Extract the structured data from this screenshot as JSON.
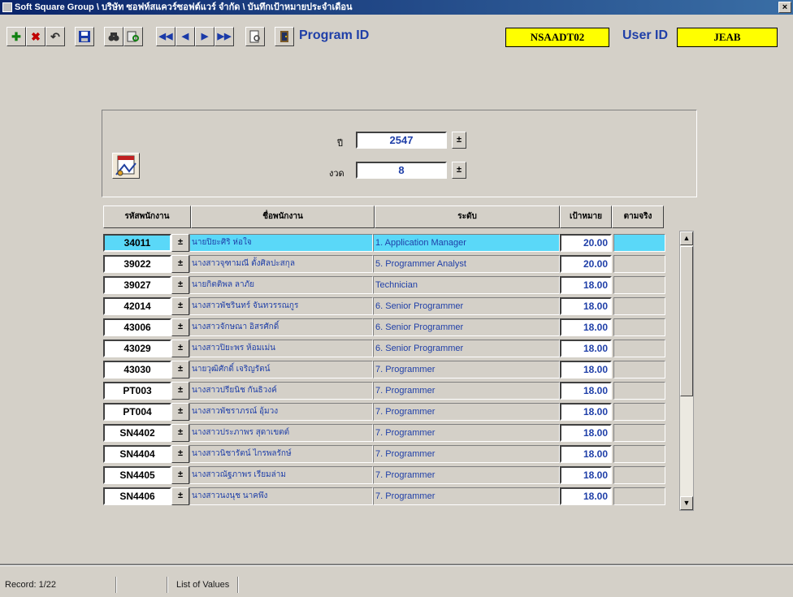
{
  "window": {
    "title": "Soft Square Group \\ บริษัท ซอฟท์สแควร์ซอฟต์แวร์ จำกัด \\ บันทึกเป้าหมายประจำเดือน",
    "close_glyph": "×"
  },
  "toolbar": {
    "program_id_label": "Program ID",
    "program_id_value": "NSAADT02",
    "user_id_label": "User ID",
    "user_id_value": "JEAB",
    "colors": {
      "label": "#1f3fa8",
      "id_box": "#ffff00"
    }
  },
  "form": {
    "year_label": "ปี",
    "year_value": "2547",
    "period_label": "งวด",
    "period_value": "8",
    "lov_glyph": "±"
  },
  "table": {
    "headers": [
      "รหัสพนักงาน",
      "ชื่อพนักงาน",
      "ระดับ",
      "เป้าหมาย",
      "ตามจริง"
    ],
    "rows": [
      {
        "code": "34011",
        "name": "นายปิยะศิริ ห่อใจ",
        "level": "1. Application Manager",
        "target": "20.00"
      },
      {
        "code": "39022",
        "name": "นางสาวจุฑามณี ตั้งศิลปะสกุล",
        "level": "5. Programmer Analyst",
        "target": "20.00"
      },
      {
        "code": "39027",
        "name": "นายกิตติพล ลาภัย",
        "level": "Technician",
        "target": "18.00"
      },
      {
        "code": "42014",
        "name": "นางสาวพัชรินทร์ จันทวรรณกูร",
        "level": "6. Senior Programmer",
        "target": "18.00"
      },
      {
        "code": "43006",
        "name": "นางสาวจักษณา อิสรศักดิ์",
        "level": "6. Senior Programmer",
        "target": "18.00"
      },
      {
        "code": "43029",
        "name": "นางสาวปิยะพร ห้อมเม่น",
        "level": "6. Senior Programmer",
        "target": "18.00"
      },
      {
        "code": "43030",
        "name": "นายวุฒิศักดิ์ เจริญรัตน์",
        "level": "7. Programmer",
        "target": "18.00"
      },
      {
        "code": "PT003",
        "name": "นางสาวปรียนิช กันธิวงค์",
        "level": "7. Programmer",
        "target": "18.00"
      },
      {
        "code": "PT004",
        "name": "นางสาวพัชราภรณ์ อุ้มวง",
        "level": "7. Programmer",
        "target": "18.00"
      },
      {
        "code": "SN4402",
        "name": "นางสาวประภาพร สุดาเขตต์",
        "level": "7. Programmer",
        "target": "18.00"
      },
      {
        "code": "SN4404",
        "name": "นางสาวนิชารัตน์ ไกรพลรักษ์",
        "level": "7. Programmer",
        "target": "18.00"
      },
      {
        "code": "SN4405",
        "name": "นางสาวณัฐภาพร เรียมล่าม",
        "level": "7. Programmer",
        "target": "18.00"
      },
      {
        "code": "SN4406",
        "name": "นางสาวนงนุช นาคพึง",
        "level": "7. Programmer",
        "target": "18.00"
      }
    ],
    "selected_index": 0,
    "colors": {
      "selected": "#5ad8f8",
      "text": "#1f3fa8"
    }
  },
  "statusbar": {
    "record": "Record: 1/22",
    "hint": "List of Values"
  }
}
